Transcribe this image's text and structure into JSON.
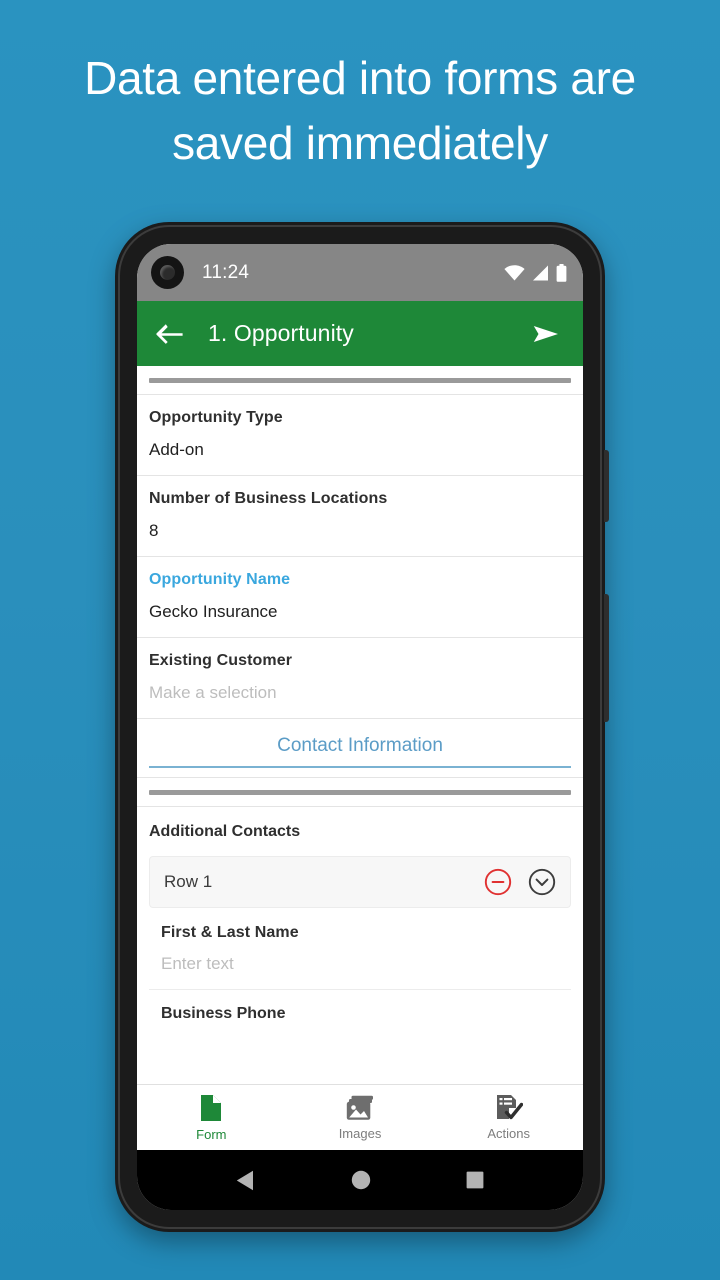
{
  "headline": "Data entered into forms are saved immediately",
  "status_bar": {
    "time": "11:24",
    "icons": [
      "wifi-icon",
      "cellular-signal-icon",
      "battery-icon"
    ]
  },
  "app_bar": {
    "back_icon": "arrow-left-icon",
    "title": "1. Opportunity",
    "send_icon": "send-arrow-icon",
    "color": "#1e8838"
  },
  "form": {
    "fields": [
      {
        "label": "Opportunity Type",
        "value": "Add-on",
        "placeholder": false,
        "accent": false
      },
      {
        "label": "Number of Business Locations",
        "value": "8",
        "placeholder": false,
        "accent": false
      },
      {
        "label": "Opportunity Name",
        "value": "Gecko Insurance",
        "placeholder": false,
        "accent": true
      },
      {
        "label": "Existing Customer",
        "value": "Make a selection",
        "placeholder": true,
        "accent": false
      }
    ],
    "section_header": "Contact Information",
    "additional_contacts_label": "Additional Contacts",
    "row": {
      "label": "Row 1",
      "remove_icon": "minus-circle-icon",
      "expand_icon": "chevron-down-circle-icon"
    },
    "nested_fields": [
      {
        "label": "First & Last Name",
        "value": "Enter text"
      }
    ],
    "cut_off_label": "Business Phone",
    "accent_color": "#3aa7de",
    "section_color": "#5b9cc6",
    "remove_color": "#e03131"
  },
  "bottom_nav": {
    "items": [
      {
        "label": "Form",
        "icon": "document-icon",
        "active": true
      },
      {
        "label": "Images",
        "icon": "images-icon",
        "active": false
      },
      {
        "label": "Actions",
        "icon": "checklist-icon",
        "active": false
      }
    ]
  },
  "system_nav": {
    "back": "triangle-back-icon",
    "home": "circle-home-icon",
    "recents": "square-recents-icon"
  }
}
